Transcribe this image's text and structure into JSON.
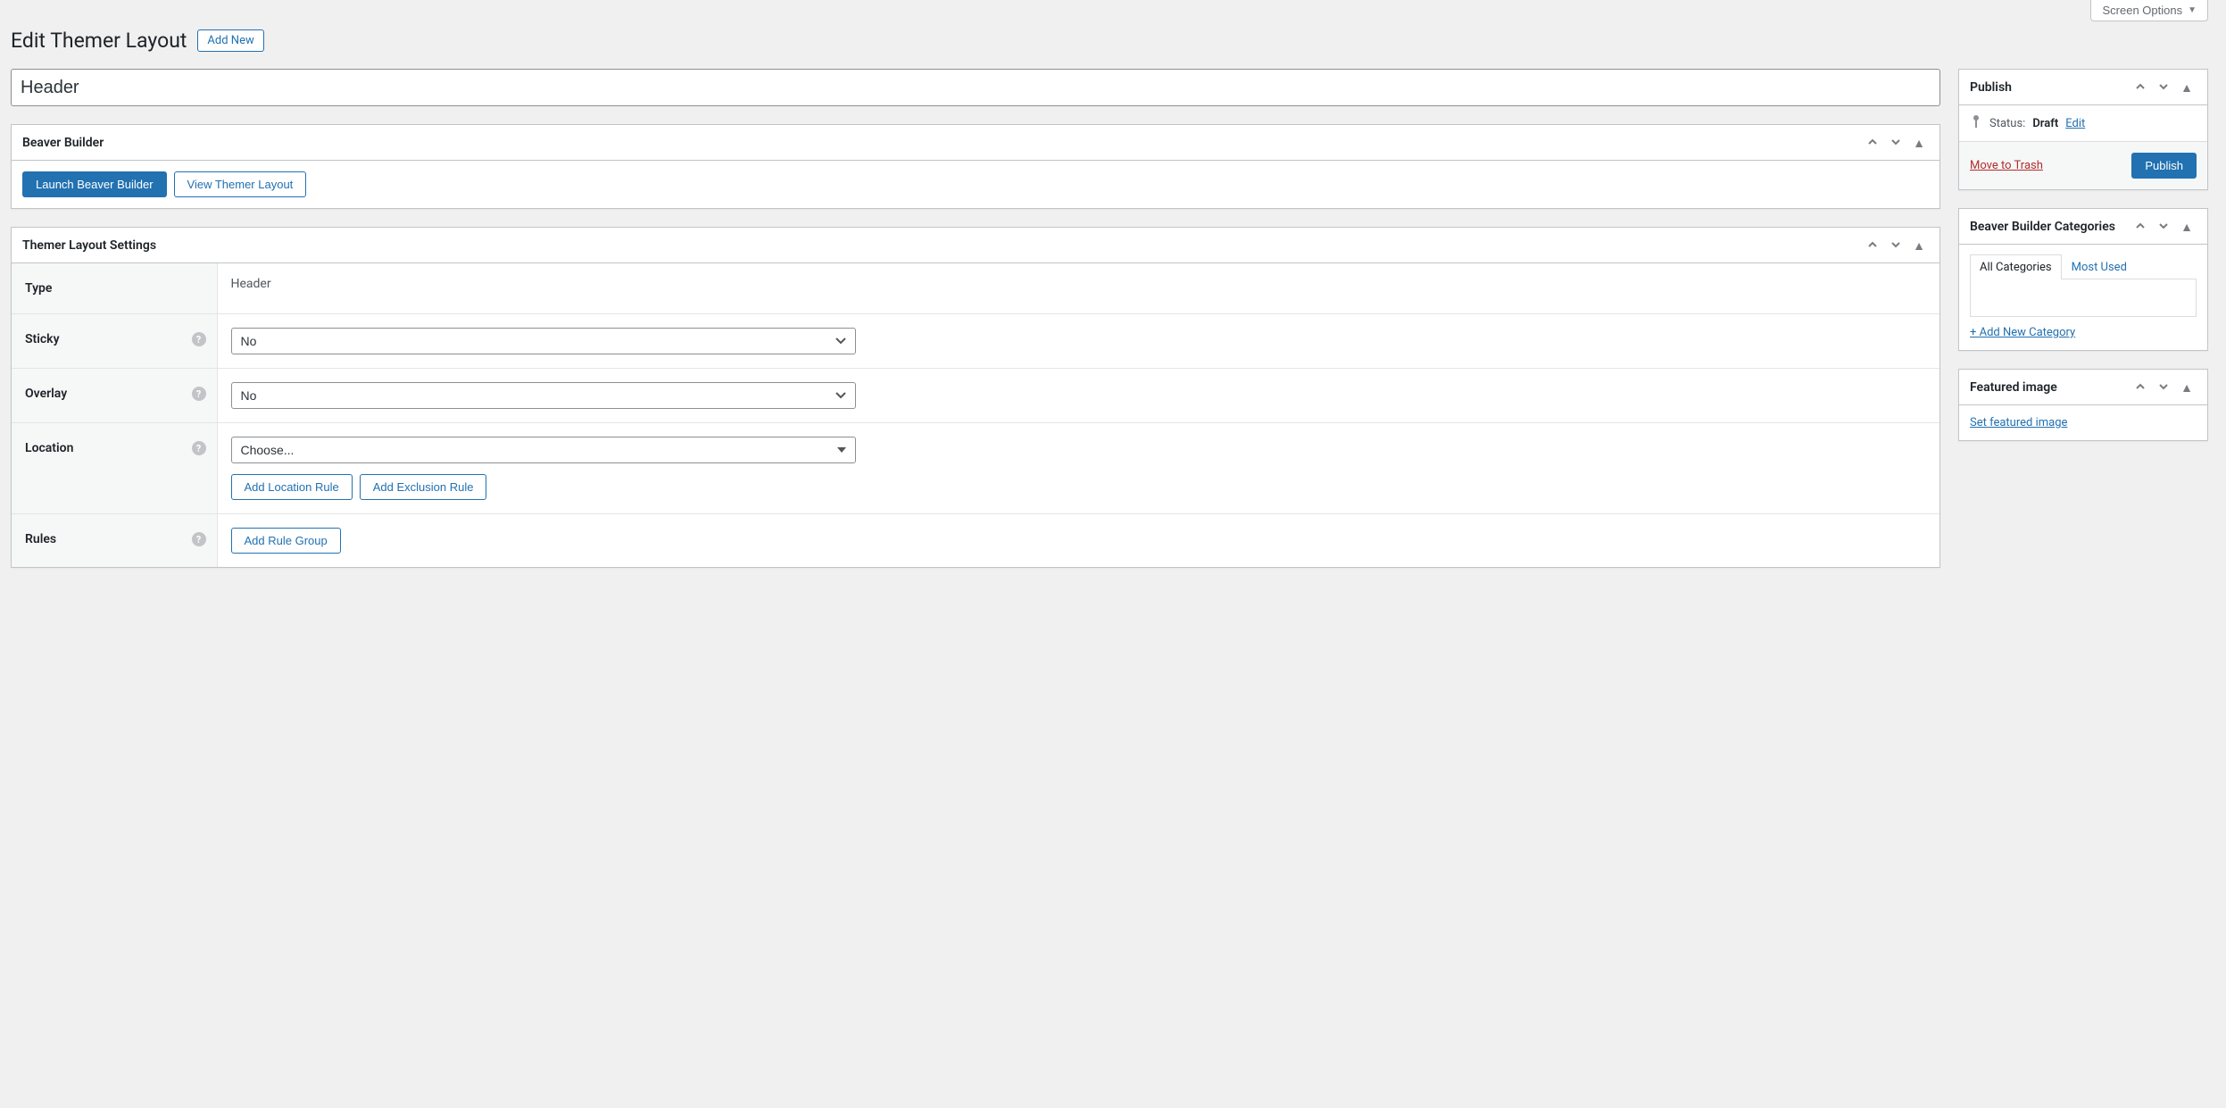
{
  "screen_options_label": "Screen Options",
  "page_title": "Edit Themer Layout",
  "add_new_label": "Add New",
  "title_value": "Header",
  "beaver_builder_box": {
    "title": "Beaver Builder",
    "launch_label": "Launch Beaver Builder",
    "view_label": "View Themer Layout"
  },
  "settings_box": {
    "title": "Themer Layout Settings",
    "rows": {
      "type": {
        "label": "Type",
        "value": "Header"
      },
      "sticky": {
        "label": "Sticky",
        "value": "No"
      },
      "overlay": {
        "label": "Overlay",
        "value": "No"
      },
      "location": {
        "label": "Location",
        "value": "Choose...",
        "add_location_label": "Add Location Rule",
        "add_exclusion_label": "Add Exclusion Rule"
      },
      "rules": {
        "label": "Rules",
        "add_rule_group_label": "Add Rule Group"
      }
    }
  },
  "publish_box": {
    "title": "Publish",
    "status_label": "Status:",
    "status_value": "Draft",
    "edit_label": "Edit",
    "trash_label": "Move to Trash",
    "publish_button": "Publish"
  },
  "categories_box": {
    "title": "Beaver Builder Categories",
    "tab_all": "All Categories",
    "tab_most_used": "Most Used",
    "add_new_label": "+ Add New Category"
  },
  "featured_image_box": {
    "title": "Featured image",
    "set_label": "Set featured image"
  }
}
